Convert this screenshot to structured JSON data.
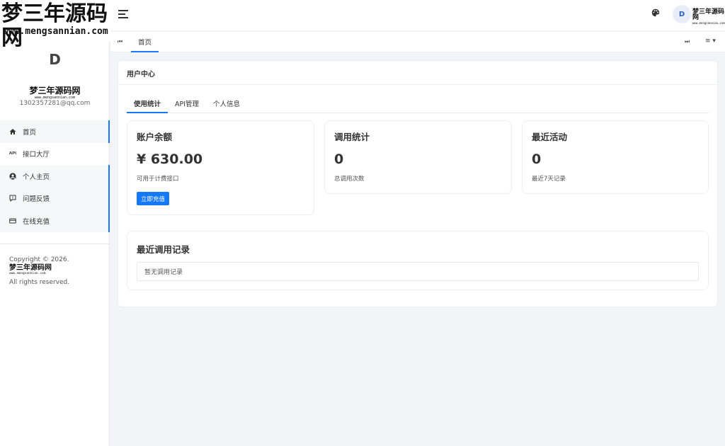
{
  "watermark": {
    "name": "梦三年源码网",
    "url": "www.mengsannian.com"
  },
  "sidebar": {
    "avatar_letter": "D",
    "brand_name": "梦三年源码网",
    "brand_url": "www.mengsannian.com",
    "email": "1302357281@qq.com",
    "items": [
      {
        "label": "首页",
        "icon": "home-icon"
      },
      {
        "label": "接口大厅",
        "icon": "api-icon"
      },
      {
        "label": "个人主页",
        "icon": "user-circle-icon"
      },
      {
        "label": "问题反馈",
        "icon": "feedback-icon"
      },
      {
        "label": "在线充值",
        "icon": "credit-card-icon"
      }
    ],
    "copyright_prefix": "Copyright © 2026.",
    "copyright_brand": "梦三年源码网",
    "copyright_brand_url": "www.mengsannian.com",
    "copyright_suffix": "All rights reserved."
  },
  "header": {
    "avatar_letter": "D",
    "brand_name": "梦三年源码网",
    "brand_url": "www.mengsannian.com"
  },
  "tabbar": {
    "tabs": [
      {
        "label": "首页"
      }
    ]
  },
  "main": {
    "title": "用户中心",
    "tabs": [
      {
        "label": "使用统计"
      },
      {
        "label": "API管理"
      },
      {
        "label": "个人信息"
      }
    ],
    "stats": [
      {
        "title": "账户余额",
        "value": "¥ 630.00",
        "sub": "可用于计费接口",
        "action": "立即充值"
      },
      {
        "title": "调用统计",
        "value": "0",
        "sub": "总调用次数"
      },
      {
        "title": "最近活动",
        "value": "0",
        "sub": "最近7天记录"
      }
    ],
    "records": {
      "title": "最近调用记录",
      "empty": "暂无调用记录"
    }
  },
  "colors": {
    "accent": "#1677ff",
    "background": "#f3f4f8"
  }
}
